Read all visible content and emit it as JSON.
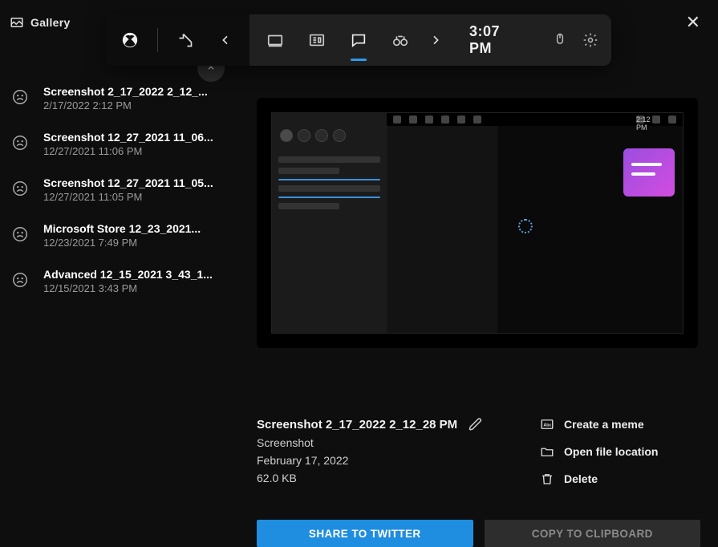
{
  "window": {
    "title": "Gallery"
  },
  "overlay": {
    "clock": "3:07 PM",
    "preview_clock": "2:12 PM"
  },
  "captures": [
    {
      "name": "Screenshot 2_17_2022 2_12_...",
      "date": "2/17/2022 2:12 PM"
    },
    {
      "name": "Screenshot 12_27_2021 11_06...",
      "date": "12/27/2021 11:06 PM"
    },
    {
      "name": "Screenshot 12_27_2021 11_05...",
      "date": "12/27/2021 11:05 PM"
    },
    {
      "name": "Microsoft Store 12_23_2021...",
      "date": "12/23/2021 7:49 PM"
    },
    {
      "name": "Advanced 12_15_2021 3_43_1...",
      "date": "12/15/2021 3:43 PM"
    }
  ],
  "selected": {
    "title": "Screenshot 2_17_2022 2_12_28 PM",
    "type": "Screenshot",
    "date": "February 17, 2022",
    "size": "62.0 KB"
  },
  "actions": {
    "meme": "Create a meme",
    "open": "Open file location",
    "delete": "Delete"
  },
  "buttons": {
    "share": "SHARE TO TWITTER",
    "copy": "COPY TO CLIPBOARD"
  }
}
